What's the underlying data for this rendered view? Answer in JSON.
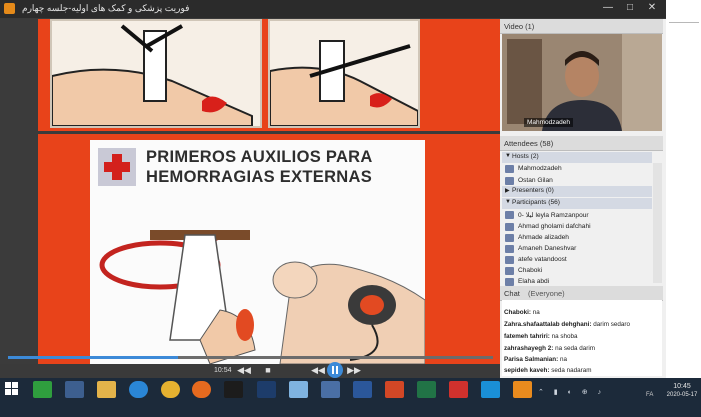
{
  "window": {
    "title": "فوریت پزشکی و کمک های اولیه-جلسه چهارم",
    "minimize": "—",
    "maximize": "□",
    "close": "✕"
  },
  "slide": {
    "title_line1": "PRIMEROS AUXILIOS PARA",
    "title_line2": "HEMORRAGIAS EXTERNAS"
  },
  "player": {
    "time": "10:54",
    "progress": 0.35
  },
  "video_panel": {
    "header": "Video  (1)",
    "presenter_name": "Mahmodzadeh"
  },
  "attendees": {
    "header": "Attendees  (58)",
    "hosts_label": "Hosts (2)",
    "hosts": [
      "Mahmodzadeh",
      "Ostan Gilan"
    ],
    "presenters_label": "Presenters (0)",
    "participants_label": "Participants (56)",
    "participants": [
      "0- لیلا leyla Ramzanpour",
      "Ahmad gholami dafchahi",
      "Ahmade alizadeh",
      "Amaneh Daneshvar",
      "atefe vatandoost",
      "Chaboki",
      "Elaha abdi"
    ]
  },
  "chat": {
    "header": "Chat",
    "scope": "(Everyone)",
    "messages": [
      {
        "from": "Chaboki:",
        "text": "na"
      },
      {
        "from": "Zahra.shafaattalab dehghani:",
        "text": "darim sedaro"
      },
      {
        "from": "fatemeh tahriri:",
        "text": "na shoba"
      },
      {
        "from": "zahrashayegh 2:",
        "text": "na seda darim"
      },
      {
        "from": "Parisa Salmanian:",
        "text": "na"
      },
      {
        "from": "sepideh kaveh:",
        "text": "seda nadaram"
      }
    ]
  },
  "taskbar": {
    "time": "10:45",
    "date": "2020-05-17",
    "lang": "FA"
  },
  "colors": {
    "slide_orange": "#e8431a",
    "accent_blue": "#3c8ad8"
  }
}
